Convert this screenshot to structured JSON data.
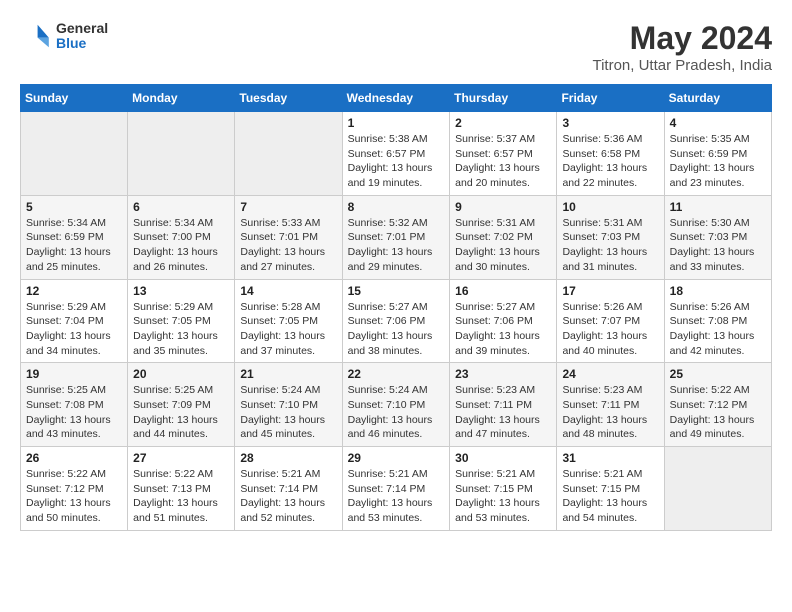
{
  "header": {
    "logo": {
      "line1": "General",
      "line2": "Blue"
    },
    "title": "May 2024",
    "subtitle": "Titron, Uttar Pradesh, India"
  },
  "weekdays": [
    "Sunday",
    "Monday",
    "Tuesday",
    "Wednesday",
    "Thursday",
    "Friday",
    "Saturday"
  ],
  "weeks": [
    [
      {
        "num": "",
        "info": ""
      },
      {
        "num": "",
        "info": ""
      },
      {
        "num": "",
        "info": ""
      },
      {
        "num": "1",
        "info": "Sunrise: 5:38 AM\nSunset: 6:57 PM\nDaylight: 13 hours and 19 minutes."
      },
      {
        "num": "2",
        "info": "Sunrise: 5:37 AM\nSunset: 6:57 PM\nDaylight: 13 hours and 20 minutes."
      },
      {
        "num": "3",
        "info": "Sunrise: 5:36 AM\nSunset: 6:58 PM\nDaylight: 13 hours and 22 minutes."
      },
      {
        "num": "4",
        "info": "Sunrise: 5:35 AM\nSunset: 6:59 PM\nDaylight: 13 hours and 23 minutes."
      }
    ],
    [
      {
        "num": "5",
        "info": "Sunrise: 5:34 AM\nSunset: 6:59 PM\nDaylight: 13 hours and 25 minutes."
      },
      {
        "num": "6",
        "info": "Sunrise: 5:34 AM\nSunset: 7:00 PM\nDaylight: 13 hours and 26 minutes."
      },
      {
        "num": "7",
        "info": "Sunrise: 5:33 AM\nSunset: 7:01 PM\nDaylight: 13 hours and 27 minutes."
      },
      {
        "num": "8",
        "info": "Sunrise: 5:32 AM\nSunset: 7:01 PM\nDaylight: 13 hours and 29 minutes."
      },
      {
        "num": "9",
        "info": "Sunrise: 5:31 AM\nSunset: 7:02 PM\nDaylight: 13 hours and 30 minutes."
      },
      {
        "num": "10",
        "info": "Sunrise: 5:31 AM\nSunset: 7:03 PM\nDaylight: 13 hours and 31 minutes."
      },
      {
        "num": "11",
        "info": "Sunrise: 5:30 AM\nSunset: 7:03 PM\nDaylight: 13 hours and 33 minutes."
      }
    ],
    [
      {
        "num": "12",
        "info": "Sunrise: 5:29 AM\nSunset: 7:04 PM\nDaylight: 13 hours and 34 minutes."
      },
      {
        "num": "13",
        "info": "Sunrise: 5:29 AM\nSunset: 7:05 PM\nDaylight: 13 hours and 35 minutes."
      },
      {
        "num": "14",
        "info": "Sunrise: 5:28 AM\nSunset: 7:05 PM\nDaylight: 13 hours and 37 minutes."
      },
      {
        "num": "15",
        "info": "Sunrise: 5:27 AM\nSunset: 7:06 PM\nDaylight: 13 hours and 38 minutes."
      },
      {
        "num": "16",
        "info": "Sunrise: 5:27 AM\nSunset: 7:06 PM\nDaylight: 13 hours and 39 minutes."
      },
      {
        "num": "17",
        "info": "Sunrise: 5:26 AM\nSunset: 7:07 PM\nDaylight: 13 hours and 40 minutes."
      },
      {
        "num": "18",
        "info": "Sunrise: 5:26 AM\nSunset: 7:08 PM\nDaylight: 13 hours and 42 minutes."
      }
    ],
    [
      {
        "num": "19",
        "info": "Sunrise: 5:25 AM\nSunset: 7:08 PM\nDaylight: 13 hours and 43 minutes."
      },
      {
        "num": "20",
        "info": "Sunrise: 5:25 AM\nSunset: 7:09 PM\nDaylight: 13 hours and 44 minutes."
      },
      {
        "num": "21",
        "info": "Sunrise: 5:24 AM\nSunset: 7:10 PM\nDaylight: 13 hours and 45 minutes."
      },
      {
        "num": "22",
        "info": "Sunrise: 5:24 AM\nSunset: 7:10 PM\nDaylight: 13 hours and 46 minutes."
      },
      {
        "num": "23",
        "info": "Sunrise: 5:23 AM\nSunset: 7:11 PM\nDaylight: 13 hours and 47 minutes."
      },
      {
        "num": "24",
        "info": "Sunrise: 5:23 AM\nSunset: 7:11 PM\nDaylight: 13 hours and 48 minutes."
      },
      {
        "num": "25",
        "info": "Sunrise: 5:22 AM\nSunset: 7:12 PM\nDaylight: 13 hours and 49 minutes."
      }
    ],
    [
      {
        "num": "26",
        "info": "Sunrise: 5:22 AM\nSunset: 7:12 PM\nDaylight: 13 hours and 50 minutes."
      },
      {
        "num": "27",
        "info": "Sunrise: 5:22 AM\nSunset: 7:13 PM\nDaylight: 13 hours and 51 minutes."
      },
      {
        "num": "28",
        "info": "Sunrise: 5:21 AM\nSunset: 7:14 PM\nDaylight: 13 hours and 52 minutes."
      },
      {
        "num": "29",
        "info": "Sunrise: 5:21 AM\nSunset: 7:14 PM\nDaylight: 13 hours and 53 minutes."
      },
      {
        "num": "30",
        "info": "Sunrise: 5:21 AM\nSunset: 7:15 PM\nDaylight: 13 hours and 53 minutes."
      },
      {
        "num": "31",
        "info": "Sunrise: 5:21 AM\nSunset: 7:15 PM\nDaylight: 13 hours and 54 minutes."
      },
      {
        "num": "",
        "info": ""
      }
    ]
  ]
}
